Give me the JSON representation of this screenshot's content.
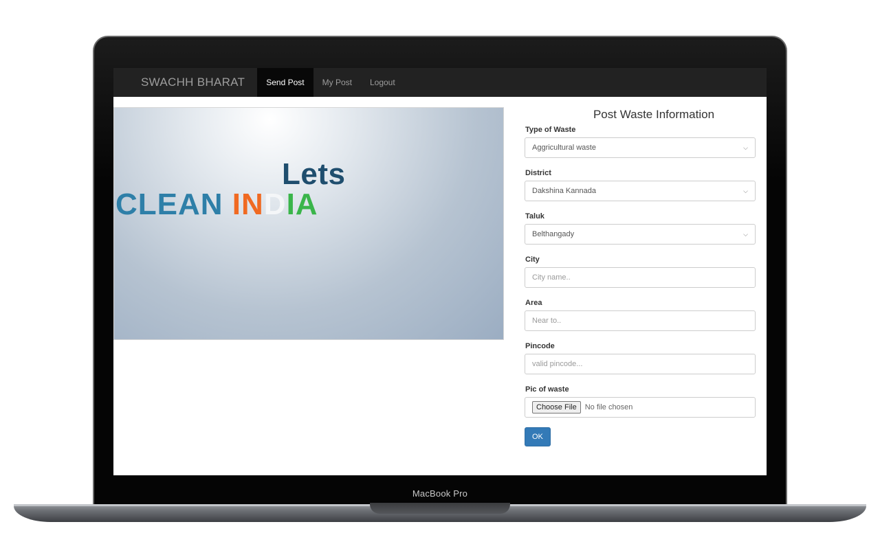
{
  "device": {
    "label": "MacBook Pro"
  },
  "navbar": {
    "brand": "SWACHH BHARAT",
    "items": [
      {
        "label": "Send Post",
        "active": true
      },
      {
        "label": "My Post",
        "active": false
      },
      {
        "label": "Logout",
        "active": false
      }
    ]
  },
  "hero": {
    "line1": "Lets",
    "clean": "CLEAN",
    "india_in": "IN",
    "india_d": "D",
    "india_ia": "IA"
  },
  "form": {
    "title": "Post Waste Information",
    "type_of_waste": {
      "label": "Type of Waste",
      "value": "Aggricultural waste"
    },
    "district": {
      "label": "District",
      "value": "Dakshina Kannada"
    },
    "taluk": {
      "label": "Taluk",
      "value": "Belthangady"
    },
    "city": {
      "label": "City",
      "placeholder": "City name.."
    },
    "area": {
      "label": "Area",
      "placeholder": "Near to.."
    },
    "pincode": {
      "label": "Pincode",
      "placeholder": "valid pincode..."
    },
    "pic": {
      "label": "Pic of waste",
      "button": "Choose File",
      "status": "No file chosen"
    },
    "submit": "OK"
  },
  "colors": {
    "navbar_bg": "#222222",
    "primary_button": "#337ab7",
    "tricolor_orange": "#f06a22",
    "tricolor_green": "#3ab54a"
  }
}
